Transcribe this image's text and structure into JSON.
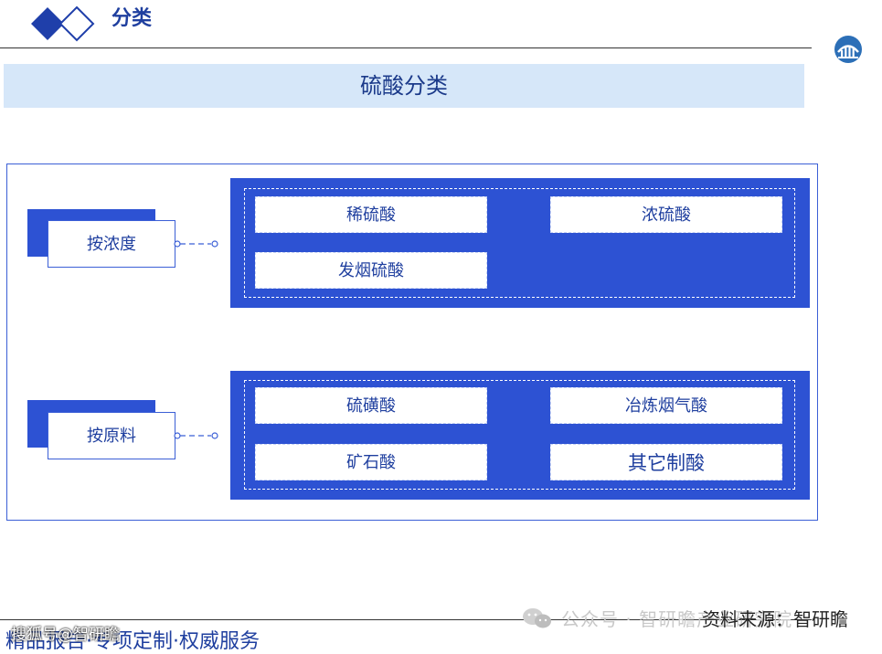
{
  "header": {
    "title": "分类"
  },
  "banner": {
    "title": "硫酸分类"
  },
  "groups": [
    {
      "label": "按浓度",
      "items": [
        "稀硫酸",
        "浓硫酸",
        "发烟硫酸"
      ]
    },
    {
      "label": "按原料",
      "items": [
        "硫磺酸",
        "冶炼烟气酸",
        "矿石酸",
        "其它制酸"
      ]
    }
  ],
  "footer": {
    "slogan": "精品报告·专项定制·权威服务",
    "watermark": "搜狐号@智研瞻",
    "wechat": "公众号 · 智研瞻产业研究院",
    "source": "资料来源：智研瞻"
  },
  "colors": {
    "accent": "#2d52d3",
    "text": "#1f3f9f",
    "banner_bg": "#d6e7f9"
  }
}
